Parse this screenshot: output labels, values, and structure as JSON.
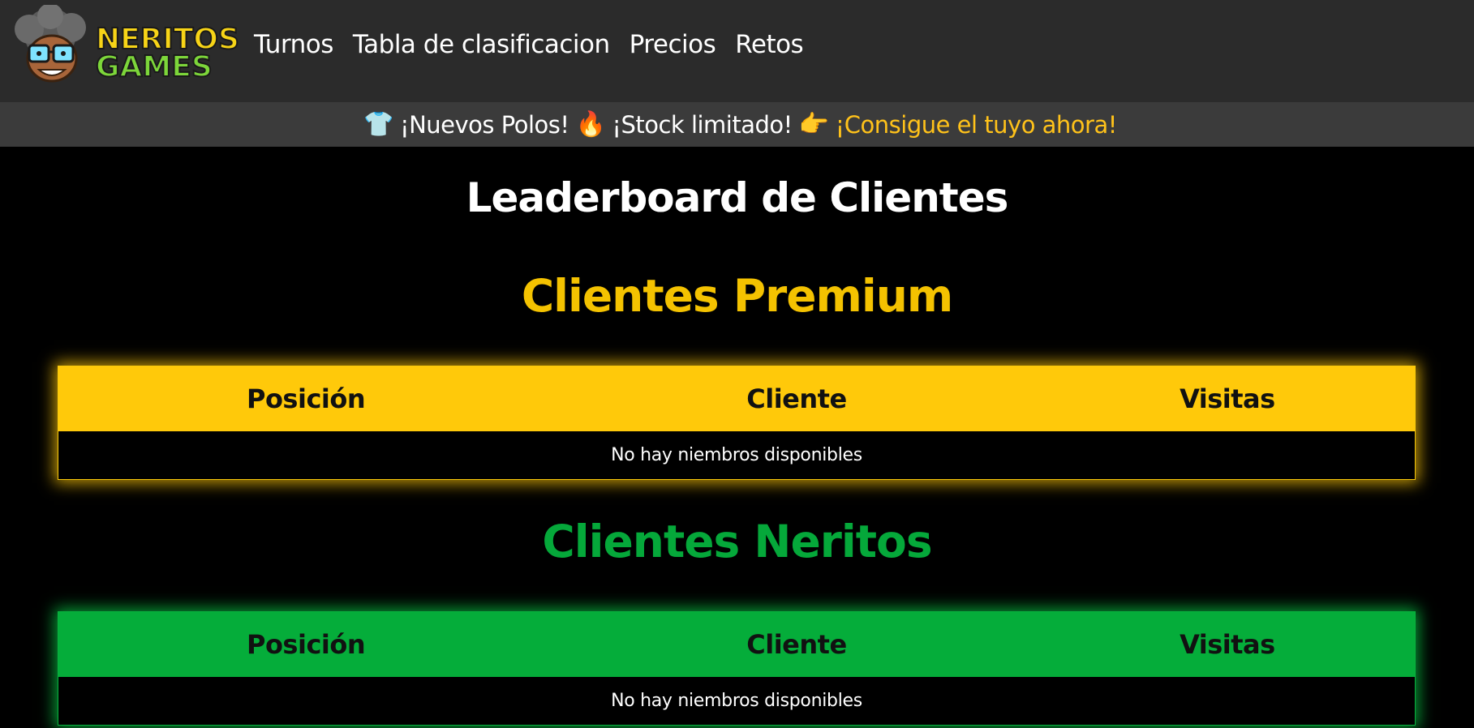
{
  "navbar": {
    "logo": {
      "line1": "NERITOS",
      "line2": "GAMES",
      "icon": "mascot-logo-icon"
    },
    "links": [
      {
        "label": "Turnos"
      },
      {
        "label": "Tabla de clasificacion"
      },
      {
        "label": "Precios"
      },
      {
        "label": "Retos"
      }
    ]
  },
  "promo": {
    "shirt_icon": "👕",
    "text1": "¡Nuevos Polos!",
    "fire_icon": "🔥",
    "text2": "¡Stock limitado!",
    "pointer_icon": "👉",
    "cta": "¡Consigue el tuyo ahora!"
  },
  "main": {
    "title": "Leaderboard de Clientes",
    "sections": [
      {
        "title": "Clientes Premium",
        "color": "#ffc90a",
        "columns": [
          "Posición",
          "Cliente",
          "Visitas"
        ],
        "empty_message": "No hay niembros disponibles"
      },
      {
        "title": "Clientes Neritos",
        "color": "#05ad3a",
        "columns": [
          "Posición",
          "Cliente",
          "Visitas"
        ],
        "empty_message": "No hay niembros disponibles"
      }
    ]
  },
  "colors": {
    "navbar_bg": "#2b2b2b",
    "promo_bg": "#3b3b3b",
    "accent_yellow": "#ffc21a",
    "accent_green": "#05ad3a",
    "page_bg": "#000000"
  }
}
